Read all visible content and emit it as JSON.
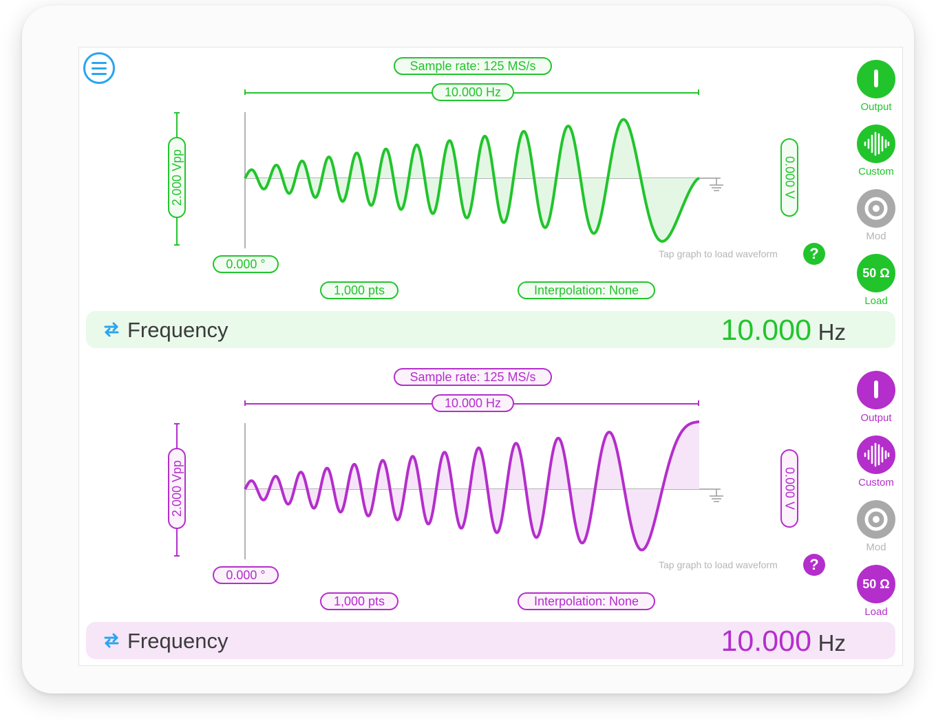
{
  "colors": {
    "menu": "#2aa5f0",
    "mod_gray": "#a9a9a9",
    "freq_icon": "#2aa5f0"
  },
  "menu": {
    "icon": "menu-icon"
  },
  "channels": [
    {
      "accent": "#22c42c",
      "fill": "#e4f7e5",
      "pill_bg": "#f3fcf3",
      "bar_bg": "#e9f9ea",
      "sample_rate": "Sample rate: 125 MS/s",
      "period_freq": "10.000 Hz",
      "amplitude": "2.000 Vpp",
      "offset": "0.000 V",
      "phase": "0.000 °",
      "points": "1,000 pts",
      "interpolation": "Interpolation: None",
      "hint": "Tap graph to load waveform",
      "help": "?",
      "waveform": {
        "type": "chirp",
        "cycles": 12,
        "start_phase_deg": 0
      },
      "buttons": {
        "output": {
          "label": "Output",
          "icon": "power-icon"
        },
        "custom": {
          "label": "Custom",
          "icon": "waveform-icon"
        },
        "mod": {
          "label": "Mod",
          "icon": "target-icon"
        },
        "load": {
          "label": "Load",
          "text": "50 Ω"
        }
      },
      "frequency": {
        "label": "Frequency",
        "value": "10.000",
        "unit": "Hz",
        "icon": "swap-arrows-icon"
      }
    },
    {
      "accent": "#b42ecb",
      "fill": "#f6e5f8",
      "pill_bg": "#fbf2fc",
      "bar_bg": "#f6e6f8",
      "sample_rate": "Sample rate: 125 MS/s",
      "period_freq": "10.000 Hz",
      "amplitude": "2.000 Vpp",
      "offset": "0.000 V",
      "phase": "0.000 °",
      "points": "1,000 pts",
      "interpolation": "Interpolation: None",
      "hint": "Tap graph to load waveform",
      "help": "?",
      "waveform": {
        "type": "chirp",
        "cycles": 12.25,
        "start_phase_deg": 0
      },
      "buttons": {
        "output": {
          "label": "Output",
          "icon": "power-icon"
        },
        "custom": {
          "label": "Custom",
          "icon": "waveform-icon"
        },
        "mod": {
          "label": "Mod",
          "icon": "target-icon"
        },
        "load": {
          "label": "Load",
          "text": "50 Ω"
        }
      },
      "frequency": {
        "label": "Frequency",
        "value": "10.000",
        "unit": "Hz",
        "icon": "swap-arrows-icon"
      }
    }
  ]
}
